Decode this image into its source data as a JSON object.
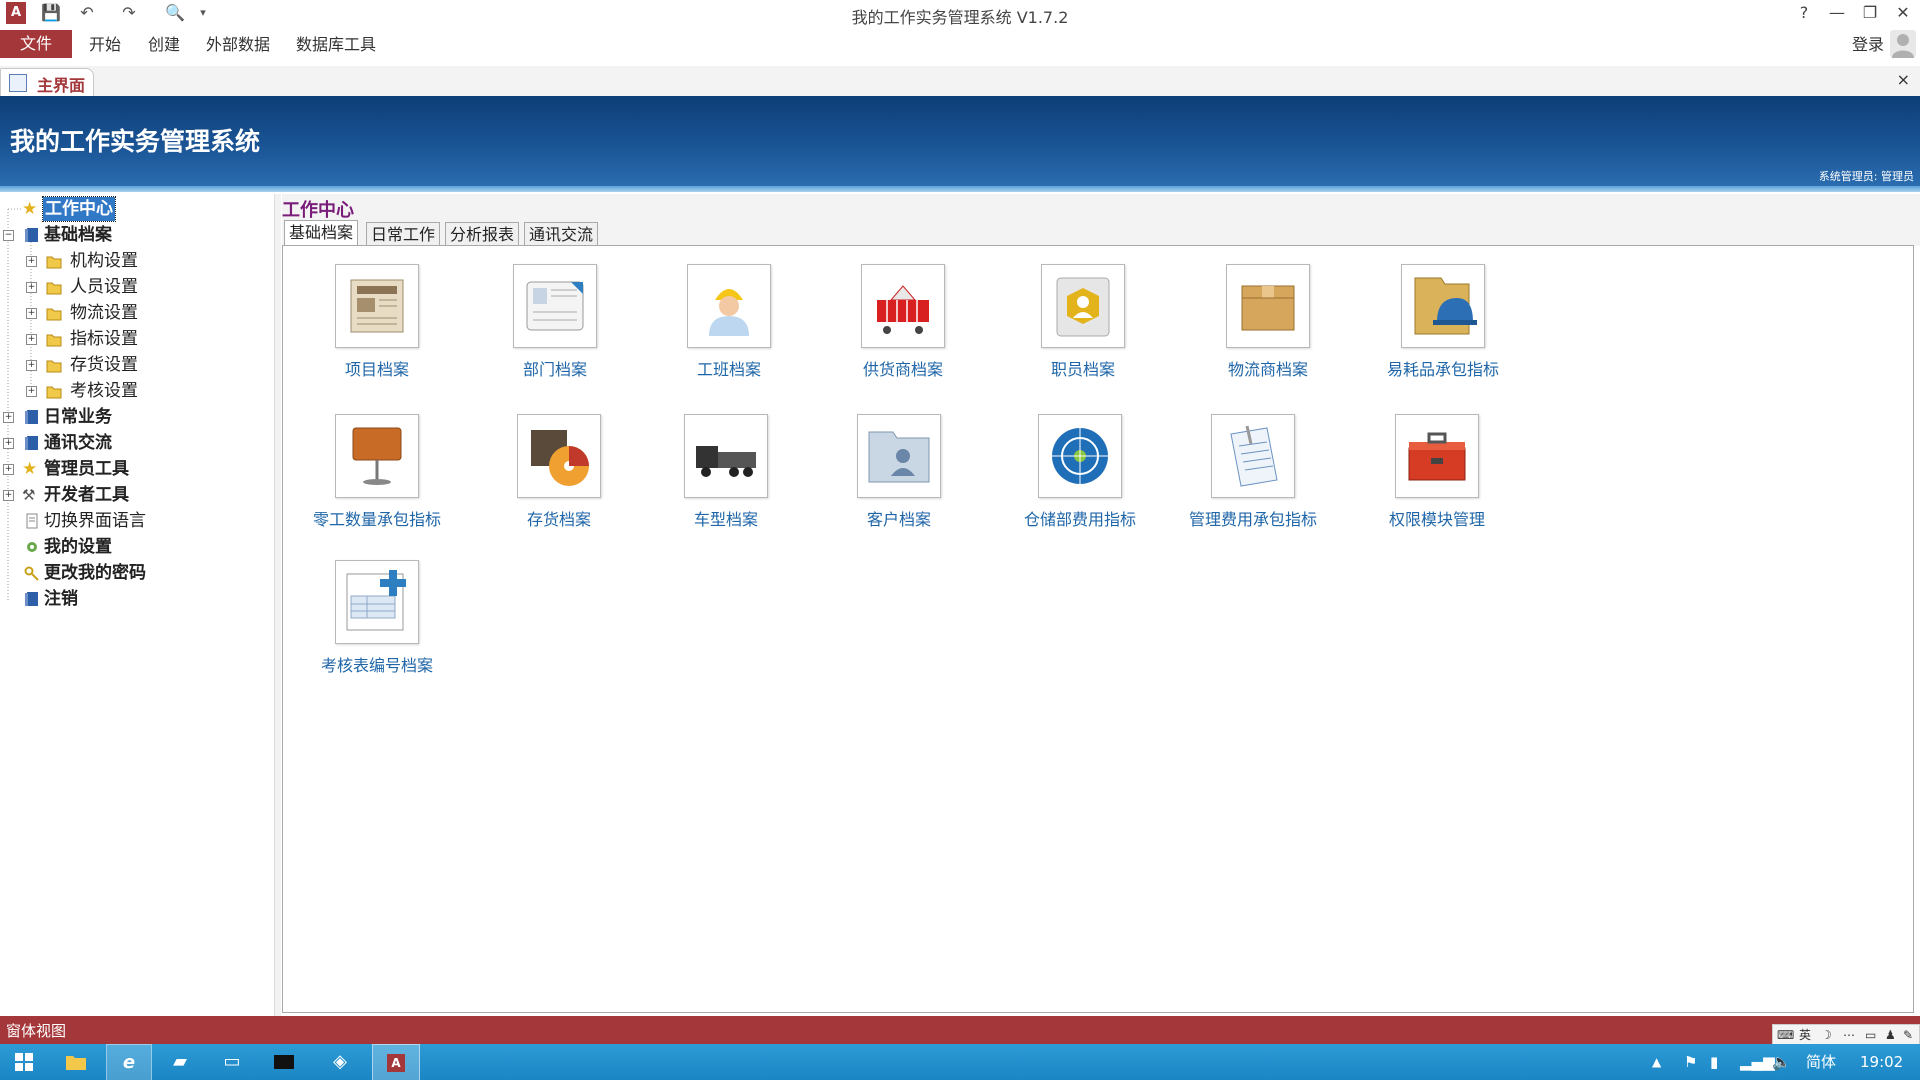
{
  "window": {
    "title": "我的工作实务管理系统 V1.7.2",
    "quick_access": [
      "app-icon",
      "save-icon",
      "undo-icon",
      "redo-icon",
      "print-preview-icon",
      "customize-icon"
    ],
    "help": "?",
    "minimize": "—",
    "restore": "❐",
    "close": "✕"
  },
  "ribbon": {
    "file": "文件",
    "tabs": [
      "开始",
      "创建",
      "外部数据",
      "数据库工具"
    ],
    "login": "登录"
  },
  "doc_tab": {
    "label": "主界面",
    "close": "×"
  },
  "banner": {
    "title": "我的工作实务管理系统",
    "user": "系统管理员: 管理员"
  },
  "tree": {
    "nodes": [
      {
        "label": "工作中心",
        "icon": "star-icon"
      },
      {
        "label": "基础档案",
        "icon": "book-icon"
      },
      {
        "label": "机构设置",
        "icon": "folder-icon"
      },
      {
        "label": "人员设置",
        "icon": "folder-icon"
      },
      {
        "label": "物流设置",
        "icon": "folder-icon"
      },
      {
        "label": "指标设置",
        "icon": "folder-icon"
      },
      {
        "label": "存货设置",
        "icon": "folder-icon"
      },
      {
        "label": "考核设置",
        "icon": "folder-icon"
      },
      {
        "label": "日常业务",
        "icon": "book-icon"
      },
      {
        "label": "通讯交流",
        "icon": "book-icon"
      },
      {
        "label": "管理员工具",
        "icon": "star-icon"
      },
      {
        "label": "开发者工具",
        "icon": "tools-icon"
      },
      {
        "label": "切换界面语言",
        "icon": "page-icon"
      },
      {
        "label": "我的设置",
        "icon": "settings-icon"
      },
      {
        "label": "更改我的密码",
        "icon": "key-icon"
      },
      {
        "label": "注销",
        "icon": "book-icon"
      }
    ]
  },
  "main": {
    "title": "工作中心",
    "tabs": [
      "基础档案",
      "日常工作",
      "分析报表",
      "通讯交流"
    ],
    "tiles": [
      {
        "label": "项目档案",
        "icon": "newspaper-icon"
      },
      {
        "label": "部门档案",
        "icon": "contact-card-icon"
      },
      {
        "label": "工班档案",
        "icon": "worker-icon"
      },
      {
        "label": "供货商档案",
        "icon": "shopping-cart-icon"
      },
      {
        "label": "职员档案",
        "icon": "user-badge-icon"
      },
      {
        "label": "物流商档案",
        "icon": "package-box-icon"
      },
      {
        "label": "易耗品承包指标",
        "icon": "helmet-folder-icon"
      },
      {
        "label": "零工数量承包指标",
        "icon": "presentation-board-icon"
      },
      {
        "label": "存货档案",
        "icon": "inventory-icon"
      },
      {
        "label": "车型档案",
        "icon": "truck-icon"
      },
      {
        "label": "客户档案",
        "icon": "user-folder-icon"
      },
      {
        "label": "仓储部费用指标",
        "icon": "target-icon"
      },
      {
        "label": "管理费用承包指标",
        "icon": "document-clip-icon"
      },
      {
        "label": "权限模块管理",
        "icon": "toolbox-icon"
      },
      {
        "label": "考核表编号档案",
        "icon": "form-add-icon"
      }
    ]
  },
  "status": {
    "text": "窗体视图",
    "ime": "英"
  },
  "taskbar": {
    "apps": [
      "start-icon",
      "file-explorer-icon",
      "ie-icon",
      "app-icon-1",
      "app-icon-2",
      "terminal-icon",
      "app-icon-3",
      "access-icon"
    ],
    "ime": "简体",
    "time": "19:02"
  },
  "colors": {
    "accent": "#a4373a",
    "banner": "#1a5495",
    "link": "#1f66a8",
    "title": "#7a1c7a"
  }
}
